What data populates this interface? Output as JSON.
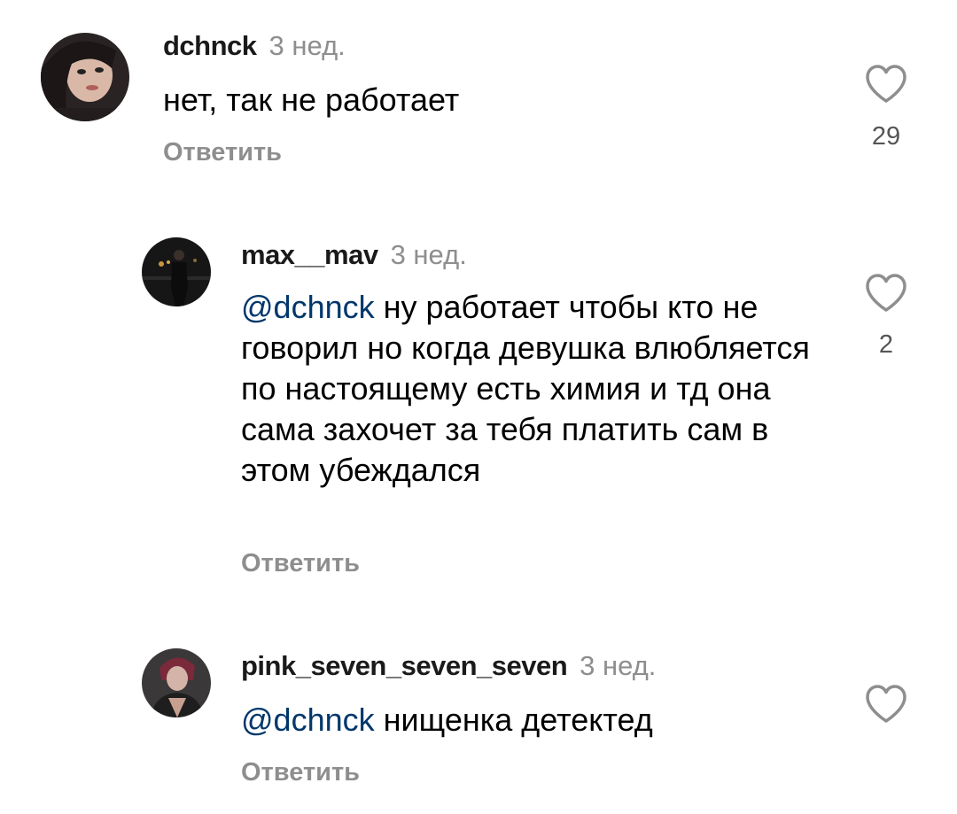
{
  "comments": [
    {
      "username": "dchnck",
      "time": "3 нед.",
      "mention": "",
      "text": "нет, так не работает",
      "reply_label": "Ответить",
      "likes": "29"
    },
    {
      "username": "max__mav",
      "time": "3 нед.",
      "mention": "@dchnck",
      "text": "ну работает чтобы кто не говорил но когда девушка влюбляется по настоящему есть химия и тд она сама захочет за тебя платить сам в этом убеждался",
      "reply_label": "Ответить",
      "likes": "2"
    },
    {
      "username": "pink_seven_seven_seven",
      "time": "3 нед.",
      "mention": "@dchnck",
      "text": "нищенка детектед",
      "reply_label": "Ответить",
      "likes": ""
    }
  ],
  "colors": {
    "username": "#1a1a1a",
    "muted": "#8e8e8e",
    "mention": "#00376b",
    "text": "#000000"
  },
  "icons": {
    "like": "heart-outline-icon"
  }
}
